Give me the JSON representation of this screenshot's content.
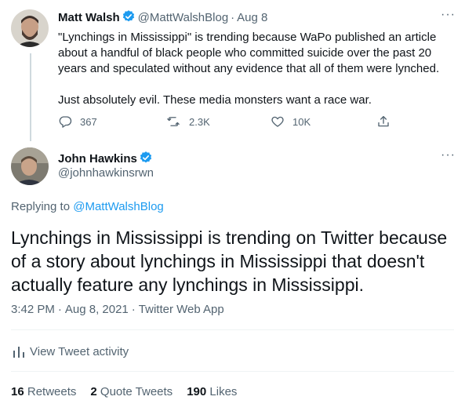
{
  "colors": {
    "accent": "#1d9bf0",
    "text": "#0f1419",
    "muted": "#536471",
    "thread_line": "#cfd9de"
  },
  "parent_tweet": {
    "name": "Matt Walsh",
    "handle": "@MattWalshBlog",
    "separator": "·",
    "date": "Aug 8",
    "paragraph1": "\"Lynchings in Mississippi\" is trending because WaPo published an article about a handful of black people who committed suicide over the past 20 years and speculated without any evidence that all of them were lynched.",
    "paragraph2": "Just absolutely evil. These media monsters want a race war.",
    "replies": "367",
    "retweets": "2.3K",
    "likes": "10K",
    "icons": [
      "verified-badge-icon",
      "more-icon",
      "reply-icon",
      "retweet-icon",
      "like-icon",
      "share-icon"
    ]
  },
  "main_tweet": {
    "name": "John Hawkins",
    "handle": "@johnhawkinsrwn",
    "replying_prefix": "Replying to",
    "replying_to": "@MattWalshBlog",
    "text": "Lynchings in Mississippi is trending on Twitter because of a story about lynchings in Mississippi that doesn't actually feature any lynchings in Mississippi.",
    "time": "3:42 PM",
    "separator": "·",
    "date": "Aug 8, 2021",
    "source": "Twitter Web App",
    "activity_label": "View Tweet activity",
    "stats": {
      "retweets_count": "16",
      "retweets_label": "Retweets",
      "quotes_count": "2",
      "quotes_label": "Quote Tweets",
      "likes_count": "190",
      "likes_label": "Likes"
    }
  }
}
